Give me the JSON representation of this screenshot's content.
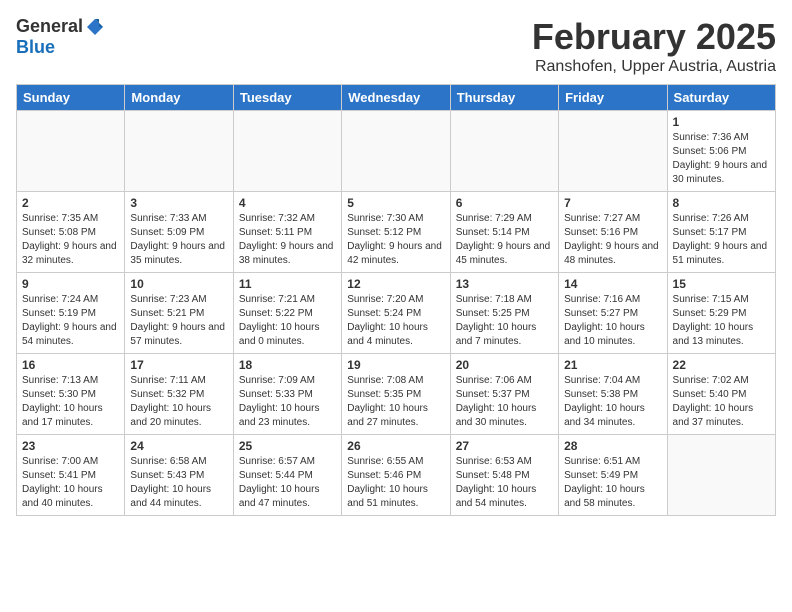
{
  "header": {
    "logo_general": "General",
    "logo_blue": "Blue",
    "month": "February 2025",
    "location": "Ranshofen, Upper Austria, Austria"
  },
  "weekdays": [
    "Sunday",
    "Monday",
    "Tuesday",
    "Wednesday",
    "Thursday",
    "Friday",
    "Saturday"
  ],
  "weeks": [
    [
      {
        "day": "",
        "info": ""
      },
      {
        "day": "",
        "info": ""
      },
      {
        "day": "",
        "info": ""
      },
      {
        "day": "",
        "info": ""
      },
      {
        "day": "",
        "info": ""
      },
      {
        "day": "",
        "info": ""
      },
      {
        "day": "1",
        "info": "Sunrise: 7:36 AM\nSunset: 5:06 PM\nDaylight: 9 hours and 30 minutes."
      }
    ],
    [
      {
        "day": "2",
        "info": "Sunrise: 7:35 AM\nSunset: 5:08 PM\nDaylight: 9 hours and 32 minutes."
      },
      {
        "day": "3",
        "info": "Sunrise: 7:33 AM\nSunset: 5:09 PM\nDaylight: 9 hours and 35 minutes."
      },
      {
        "day": "4",
        "info": "Sunrise: 7:32 AM\nSunset: 5:11 PM\nDaylight: 9 hours and 38 minutes."
      },
      {
        "day": "5",
        "info": "Sunrise: 7:30 AM\nSunset: 5:12 PM\nDaylight: 9 hours and 42 minutes."
      },
      {
        "day": "6",
        "info": "Sunrise: 7:29 AM\nSunset: 5:14 PM\nDaylight: 9 hours and 45 minutes."
      },
      {
        "day": "7",
        "info": "Sunrise: 7:27 AM\nSunset: 5:16 PM\nDaylight: 9 hours and 48 minutes."
      },
      {
        "day": "8",
        "info": "Sunrise: 7:26 AM\nSunset: 5:17 PM\nDaylight: 9 hours and 51 minutes."
      }
    ],
    [
      {
        "day": "9",
        "info": "Sunrise: 7:24 AM\nSunset: 5:19 PM\nDaylight: 9 hours and 54 minutes."
      },
      {
        "day": "10",
        "info": "Sunrise: 7:23 AM\nSunset: 5:21 PM\nDaylight: 9 hours and 57 minutes."
      },
      {
        "day": "11",
        "info": "Sunrise: 7:21 AM\nSunset: 5:22 PM\nDaylight: 10 hours and 0 minutes."
      },
      {
        "day": "12",
        "info": "Sunrise: 7:20 AM\nSunset: 5:24 PM\nDaylight: 10 hours and 4 minutes."
      },
      {
        "day": "13",
        "info": "Sunrise: 7:18 AM\nSunset: 5:25 PM\nDaylight: 10 hours and 7 minutes."
      },
      {
        "day": "14",
        "info": "Sunrise: 7:16 AM\nSunset: 5:27 PM\nDaylight: 10 hours and 10 minutes."
      },
      {
        "day": "15",
        "info": "Sunrise: 7:15 AM\nSunset: 5:29 PM\nDaylight: 10 hours and 13 minutes."
      }
    ],
    [
      {
        "day": "16",
        "info": "Sunrise: 7:13 AM\nSunset: 5:30 PM\nDaylight: 10 hours and 17 minutes."
      },
      {
        "day": "17",
        "info": "Sunrise: 7:11 AM\nSunset: 5:32 PM\nDaylight: 10 hours and 20 minutes."
      },
      {
        "day": "18",
        "info": "Sunrise: 7:09 AM\nSunset: 5:33 PM\nDaylight: 10 hours and 23 minutes."
      },
      {
        "day": "19",
        "info": "Sunrise: 7:08 AM\nSunset: 5:35 PM\nDaylight: 10 hours and 27 minutes."
      },
      {
        "day": "20",
        "info": "Sunrise: 7:06 AM\nSunset: 5:37 PM\nDaylight: 10 hours and 30 minutes."
      },
      {
        "day": "21",
        "info": "Sunrise: 7:04 AM\nSunset: 5:38 PM\nDaylight: 10 hours and 34 minutes."
      },
      {
        "day": "22",
        "info": "Sunrise: 7:02 AM\nSunset: 5:40 PM\nDaylight: 10 hours and 37 minutes."
      }
    ],
    [
      {
        "day": "23",
        "info": "Sunrise: 7:00 AM\nSunset: 5:41 PM\nDaylight: 10 hours and 40 minutes."
      },
      {
        "day": "24",
        "info": "Sunrise: 6:58 AM\nSunset: 5:43 PM\nDaylight: 10 hours and 44 minutes."
      },
      {
        "day": "25",
        "info": "Sunrise: 6:57 AM\nSunset: 5:44 PM\nDaylight: 10 hours and 47 minutes."
      },
      {
        "day": "26",
        "info": "Sunrise: 6:55 AM\nSunset: 5:46 PM\nDaylight: 10 hours and 51 minutes."
      },
      {
        "day": "27",
        "info": "Sunrise: 6:53 AM\nSunset: 5:48 PM\nDaylight: 10 hours and 54 minutes."
      },
      {
        "day": "28",
        "info": "Sunrise: 6:51 AM\nSunset: 5:49 PM\nDaylight: 10 hours and 58 minutes."
      },
      {
        "day": "",
        "info": ""
      }
    ]
  ]
}
